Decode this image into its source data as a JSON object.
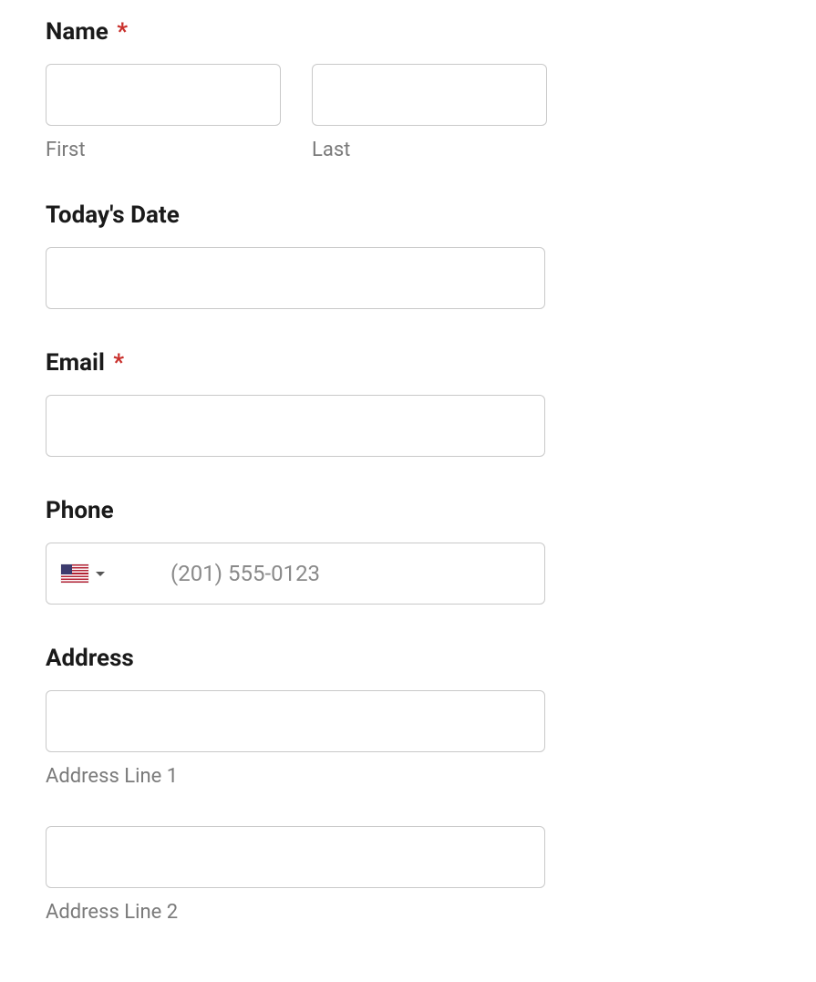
{
  "form": {
    "name": {
      "label": "Name",
      "required_marker": "*",
      "first_sub": "First",
      "last_sub": "Last",
      "first_value": "",
      "last_value": ""
    },
    "date": {
      "label": "Today's Date",
      "value": ""
    },
    "email": {
      "label": "Email",
      "required_marker": "*",
      "value": ""
    },
    "phone": {
      "label": "Phone",
      "placeholder": "(201) 555-0123",
      "value": "",
      "country_code": "US"
    },
    "address": {
      "label": "Address",
      "line1_sub": "Address Line 1",
      "line1_value": "",
      "line2_sub": "Address Line 2",
      "line2_value": ""
    }
  }
}
